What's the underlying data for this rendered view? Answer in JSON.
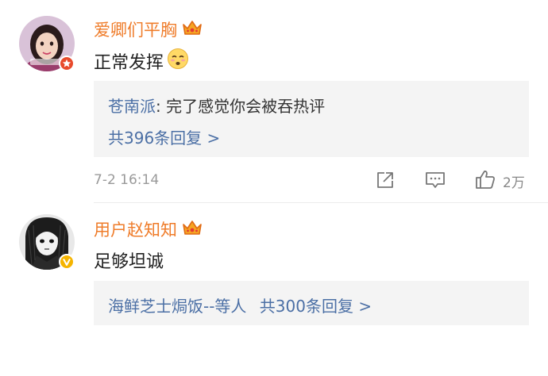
{
  "comments": [
    {
      "username": "爱卿们平胸",
      "text": "正常发挥",
      "avatar_badge": "vip-red",
      "reply_preview": {
        "author": "苍南派",
        "separator": ": ",
        "text": "完了感觉你会被吞热评"
      },
      "reply_count_label": "共396条回复 >",
      "timestamp": "7-2 16:14",
      "like_count": "2万"
    },
    {
      "username": "用户赵知知",
      "text": "足够坦诚",
      "avatar_badge": "verified-gold",
      "reply_summary": {
        "authors": "海鲜芝士焗饭--等人",
        "count_label": "共300条回复 >"
      }
    }
  ],
  "colors": {
    "username": "#ef7c2a",
    "link": "#4b6fa5",
    "meta": "#9a9a9a",
    "reply_bg": "#f4f4f4"
  },
  "icons": [
    "crown-icon",
    "awkward-emoji-icon",
    "share-icon",
    "reply-comment-icon",
    "thumbs-up-icon"
  ]
}
